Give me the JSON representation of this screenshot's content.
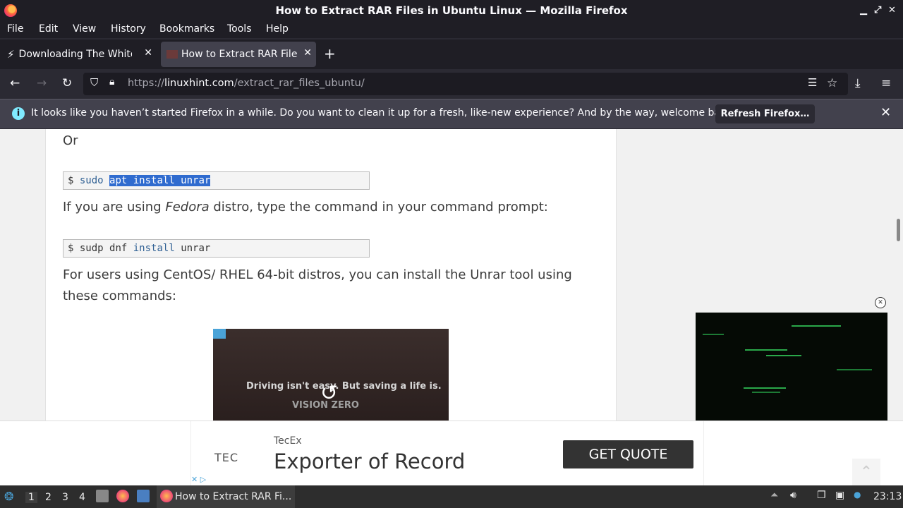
{
  "window": {
    "title": "How to Extract RAR Files in Ubuntu Linux — Mozilla Firefox"
  },
  "menu": [
    "File",
    "Edit",
    "View",
    "History",
    "Bookmarks",
    "Tools",
    "Help"
  ],
  "tabs": [
    {
      "label": "Downloading The White H",
      "active": false
    },
    {
      "label": "How to Extract RAR Files",
      "active": true
    }
  ],
  "url": {
    "prefix": "https://",
    "host": "linuxhint.com",
    "path": "/extract_rar_files_ubuntu/"
  },
  "notification": {
    "text": "It looks like you haven’t started Firefox in a while. Do you want to clean it up for a fresh, like-new experience? And by the way, welcome back!",
    "button": "Refresh Firefox…"
  },
  "article": {
    "or": "Or",
    "cmd1": {
      "prompt": "$",
      "pre": "sudo",
      "selected": "apt install unrar"
    },
    "fedora_pre": "If you are using ",
    "fedora_em": "Fedora",
    "fedora_post": " distro, type the command in your command prompt:",
    "cmd2": {
      "prompt": "$",
      "a": "sudp dnf",
      "kw": "install",
      "b": "unrar"
    },
    "centos_line1": "For users using CentOS/ RHEL 64-bit distros, you can install the Unrar tool using",
    "centos_line2": "these commands:"
  },
  "video_ad": {
    "text": "Driving isn't easy. But saving a life is.",
    "sub": "VISION ZERO"
  },
  "bottom_ad": {
    "logo": "TEC",
    "brand": "TecEx",
    "headline": "Exporter of Record",
    "cta": "GET QUOTE"
  },
  "taskbar": {
    "workspaces": [
      "1",
      "2",
      "3",
      "4"
    ],
    "active_workspace": "1",
    "task_label": "How to Extract RAR Fi...",
    "clock": "23:13"
  }
}
